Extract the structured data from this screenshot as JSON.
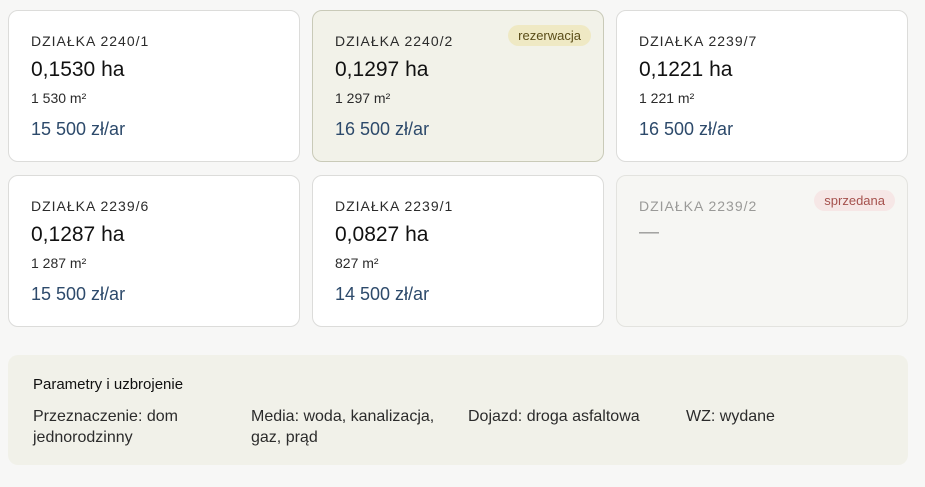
{
  "plots": [
    {
      "title": "DZIAŁKA 2240/1",
      "area": "0,1530 ha",
      "m2": "1 530 m²",
      "price": "15 500 zł/ar",
      "status": "available",
      "badge": ""
    },
    {
      "title": "DZIAŁKA 2240/2",
      "area": "0,1297 ha",
      "m2": "1 297 m²",
      "price": "16 500 zł/ar",
      "status": "reserved",
      "badge": "rezerwacja"
    },
    {
      "title": "DZIAŁKA 2239/7",
      "area": "0,1221 ha",
      "m2": "1 221 m²",
      "price": "16 500 zł/ar",
      "status": "available",
      "badge": ""
    },
    {
      "title": "DZIAŁKA 2239/6",
      "area": "0,1287 ha",
      "m2": "1 287 m²",
      "price": "15 500 zł/ar",
      "status": "available",
      "badge": ""
    },
    {
      "title": "DZIAŁKA 2239/1",
      "area": "0,0827 ha",
      "m2": "827 m²",
      "price": "14 500 zł/ar",
      "status": "available",
      "badge": ""
    },
    {
      "title": "DZIAŁKA 2239/2",
      "area": "—",
      "m2": "",
      "price": "",
      "status": "sold",
      "badge": "sprzedana"
    }
  ],
  "params": {
    "title": "Parametry i uzbrojenie",
    "items": [
      "Przeznaczenie: dom jednorodzinny",
      "Media: woda, kanalizacja, gaz, prąd",
      "Dojazd: droga asfaltowa",
      "WZ: wydane"
    ]
  },
  "colors": {
    "price": "#2d4a6b",
    "reserved_badge_bg": "#efe9c4",
    "sold_badge_bg": "#f6e7e6",
    "sold_badge_text": "#a5514d"
  }
}
